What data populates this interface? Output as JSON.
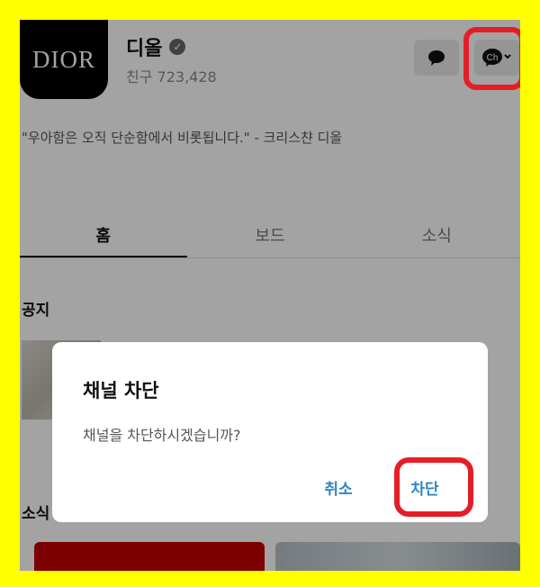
{
  "profile": {
    "logo_text": "DIOR",
    "name": "디올",
    "friends": "친구 723,428",
    "quote": "\"우아함은 오직 단순함에서 비롯됩니다.\" - 크리스챤 디올"
  },
  "header_buttons": {
    "chat_icon": "speech-bubble-icon",
    "channel_icon": "ch-menu-icon",
    "channel_label": "Ch"
  },
  "tabs": [
    {
      "label": "홈",
      "active": true
    },
    {
      "label": "보드",
      "active": false
    },
    {
      "label": "소식",
      "active": false
    }
  ],
  "sections": {
    "notice": "공지",
    "news": "소식"
  },
  "dialog": {
    "title": "채널 차단",
    "message": "채널을 차단하시겠습니까?",
    "cancel_label": "취소",
    "confirm_label": "차단"
  },
  "colors": {
    "frame": "#ffff00",
    "highlight": "#e41e26",
    "action": "#2f86c6"
  }
}
